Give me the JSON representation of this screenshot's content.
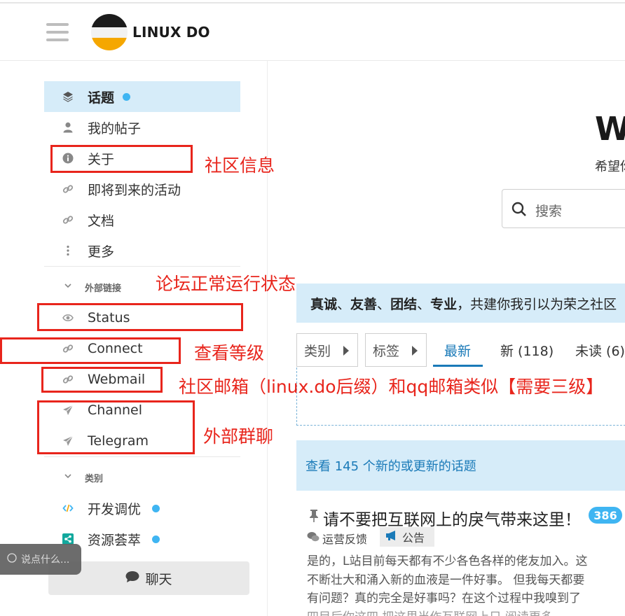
{
  "header": {
    "brand": "LINUX DO",
    "colors": {
      "logo_top": "#1c1c1c",
      "logo_middle": "#f2f2f2",
      "logo_bottom": "#f5a700"
    }
  },
  "sidebar": {
    "items": [
      {
        "label": "话题",
        "icon": "layers-icon",
        "active": true,
        "has_dot": true
      },
      {
        "label": "我的帖子",
        "icon": "user-icon"
      },
      {
        "label": "关于",
        "icon": "info-icon"
      },
      {
        "label": "即将到来的活动",
        "icon": "link-icon"
      },
      {
        "label": "文档",
        "icon": "link-icon"
      },
      {
        "label": "更多",
        "icon": "more-vertical-icon"
      }
    ],
    "external_section": {
      "title": "外部链接",
      "items": [
        {
          "label": "Status",
          "icon": "eye-icon"
        },
        {
          "label": "Connect",
          "icon": "link-icon"
        },
        {
          "label": "Webmail",
          "icon": "link-icon"
        },
        {
          "label": "Channel",
          "icon": "paper-plane-icon"
        },
        {
          "label": "Telegram",
          "icon": "paper-plane-icon"
        }
      ]
    },
    "categories_section": {
      "title": "类别",
      "items": [
        {
          "label": "开发调优",
          "icon": "code-icon",
          "icon_color": "#3fb5f2",
          "has_dot": true
        },
        {
          "label": "资源荟萃",
          "icon": "share-icon",
          "icon_color": "#12a89d",
          "has_dot": true
        }
      ]
    },
    "chat_label": "聊天",
    "chat_placeholder": "说点什么..."
  },
  "main": {
    "title_partial": "W",
    "subtitle_partial": "希望你",
    "search_placeholder": "搜索",
    "banner": {
      "bold_parts": [
        "真诚",
        "友善",
        "团结",
        "专业"
      ],
      "text": "，共建你我引以为荣之社区"
    },
    "filters": [
      "类别",
      "标签"
    ],
    "tabs": [
      "最新",
      "新 (118)",
      "未读 (6)"
    ],
    "active_tab": "最新",
    "new_topics_text": "查看 145 个新的或更新的话题",
    "topic": {
      "title": "请不要把互联网上的戾气带来这里！",
      "reply_count": "386",
      "category": "运营反馈",
      "tag": "公告",
      "excerpt_lines": [
        "是的，L站目前每天都有不少各色各样的佬友加入。这",
        "不断壮大和涌入新的血液是一件好事。 但我每天都要",
        "有问题？真的完全是好事吗？在这个过程中我嗅到了",
        "四目后你这四 把这里当作互联网上只 阅读更多"
      ]
    }
  },
  "annotations": {
    "about": "社区信息",
    "status": "论坛正常运行状态",
    "connect": "查看等级",
    "webmail": "社区邮箱（linux.do后缀）和qq邮箱类似【需要三级】",
    "groups": "外部群聊",
    "color": "#e8251c"
  }
}
